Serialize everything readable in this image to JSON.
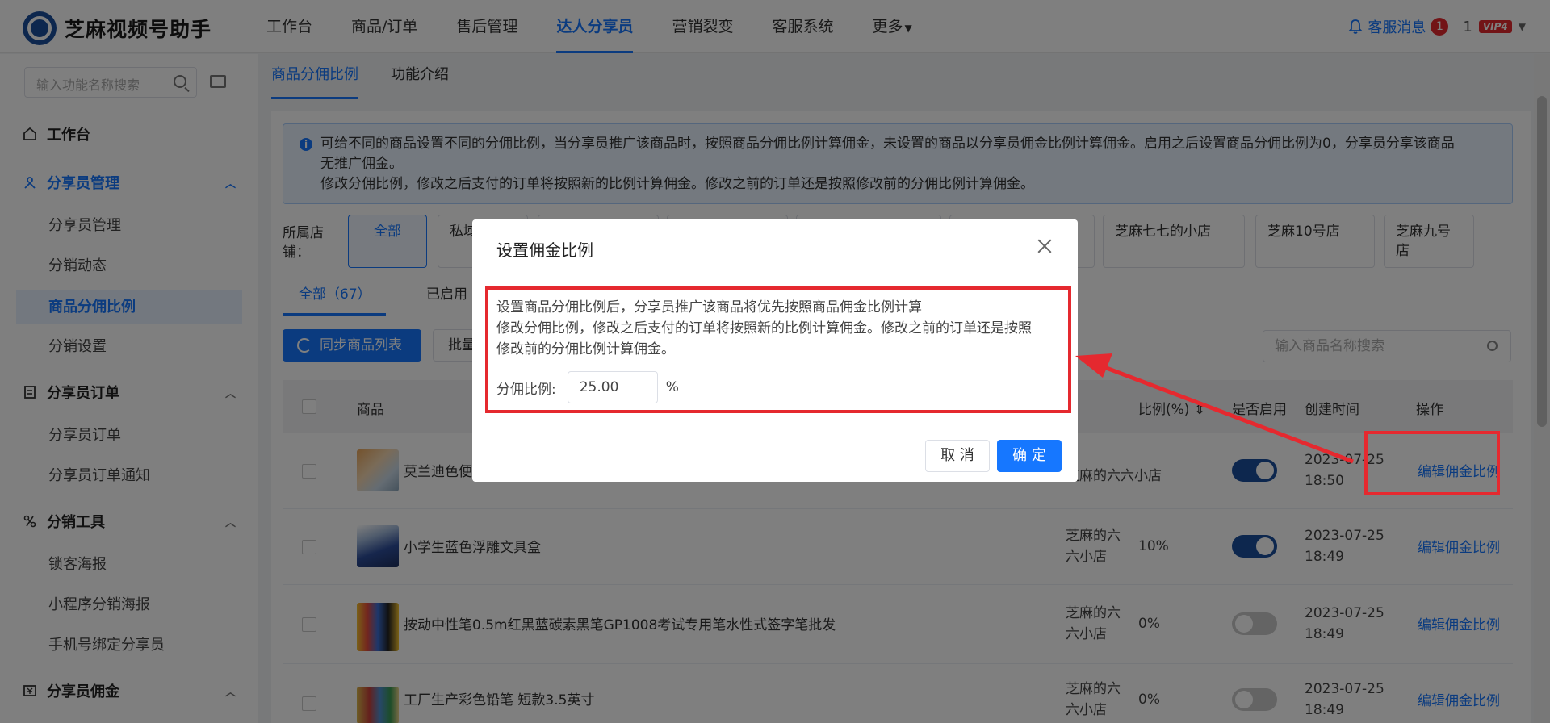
{
  "app": {
    "name": "芝麻视频号助手"
  },
  "nav": {
    "items": [
      "工作台",
      "商品/订单",
      "售后管理",
      "达人分享员",
      "营销裂变",
      "客服系统",
      "更多"
    ],
    "active_index": 3,
    "messages_label": "客服消息",
    "messages_count": "1",
    "account": "1",
    "vip": "VIP4"
  },
  "sidebar": {
    "search_placeholder": "输入功能名称搜索",
    "workbench": "工作台",
    "sections": [
      {
        "title": "分享员管理",
        "items": [
          "分享员管理",
          "分销动态",
          "商品分佣比例",
          "分销设置"
        ]
      },
      {
        "title": "分享员订单",
        "items": [
          "分享员订单",
          "分享员订单通知"
        ]
      },
      {
        "title": "分销工具",
        "items": [
          "锁客海报",
          "小程序分销海报",
          "手机号绑定分享员"
        ]
      },
      {
        "title": "分享员佣金",
        "items": []
      }
    ],
    "active_item": "商品分佣比例"
  },
  "main": {
    "tabs": [
      "商品分佣比例",
      "功能介绍"
    ],
    "alert_line1": "可给不同的商品设置不同的分佣比例，当分享员推广该商品时，按照商品分佣比例计算佣金，未设置的商品以分享员佣金比例计算佣金。启用之后设置商品分佣比例为0，分享员分享该商品",
    "alert_line2": "无推广佣金。",
    "alert_line3": "修改分佣比例，修改之后支付的订单将按照新的比例计算佣金。修改之前的订单还是按照修改前的分佣比例计算佣金。",
    "store_label": "所属店铺：",
    "stores": [
      "全部",
      "私域",
      "",
      "",
      "",
      "",
      "芝麻七七的小店",
      "芝麻10号店",
      "芝麻九号店"
    ],
    "subtabs": [
      "全部（67）",
      "已启用"
    ],
    "sync_button": "同步商品列表",
    "batch_button": "批量",
    "goods_search_placeholder": "输入商品名称搜索",
    "table_headers": {
      "product": "商品",
      "ratio": "比例(%)",
      "enabled": "是否启用",
      "created": "创建时间",
      "action": "操作"
    },
    "rows": [
      {
        "name": "莫兰迪色便",
        "store": "芝麻的六六小店",
        "ratio": "",
        "enabled": true,
        "date": "2023-07-25",
        "time": "18:50",
        "action": "编辑佣金比例"
      },
      {
        "name": "小学生蓝色浮雕文具盒",
        "store": "芝麻的六六小店",
        "ratio": "10%",
        "enabled": true,
        "date": "2023-07-25",
        "time": "18:49",
        "action": "编辑佣金比例"
      },
      {
        "name": "按动中性笔0.5m红黑蓝碳素黑笔GP1008考试专用笔水性式签字笔批发",
        "store": "芝麻的六六小店",
        "ratio": "0%",
        "enabled": false,
        "date": "2023-07-25",
        "time": "18:49",
        "action": "编辑佣金比例"
      },
      {
        "name": "工厂生产彩色铅笔 短款3.5英寸",
        "store": "芝麻的六六小店",
        "ratio": "0%",
        "enabled": false,
        "date": "2023-07-25",
        "time": "18:49",
        "action": "编辑佣金比例"
      }
    ]
  },
  "modal": {
    "title": "设置佣金比例",
    "desc_line1": "设置商品分佣比例后，分享员推广该商品将优先按照商品佣金比例计算",
    "desc_line2": "修改分佣比例，修改之后支付的订单将按照新的比例计算佣金。修改之前的订单还是按照",
    "desc_line3": "修改前的分佣比例计算佣金。",
    "rate_label": "分佣比例:",
    "rate_value": "25.00",
    "rate_unit": "%",
    "cancel": "取 消",
    "ok": "确 定"
  },
  "colors": {
    "primary": "#1677ff",
    "highlight": "#e5292f",
    "toggle_on": "#1b4f9c"
  }
}
